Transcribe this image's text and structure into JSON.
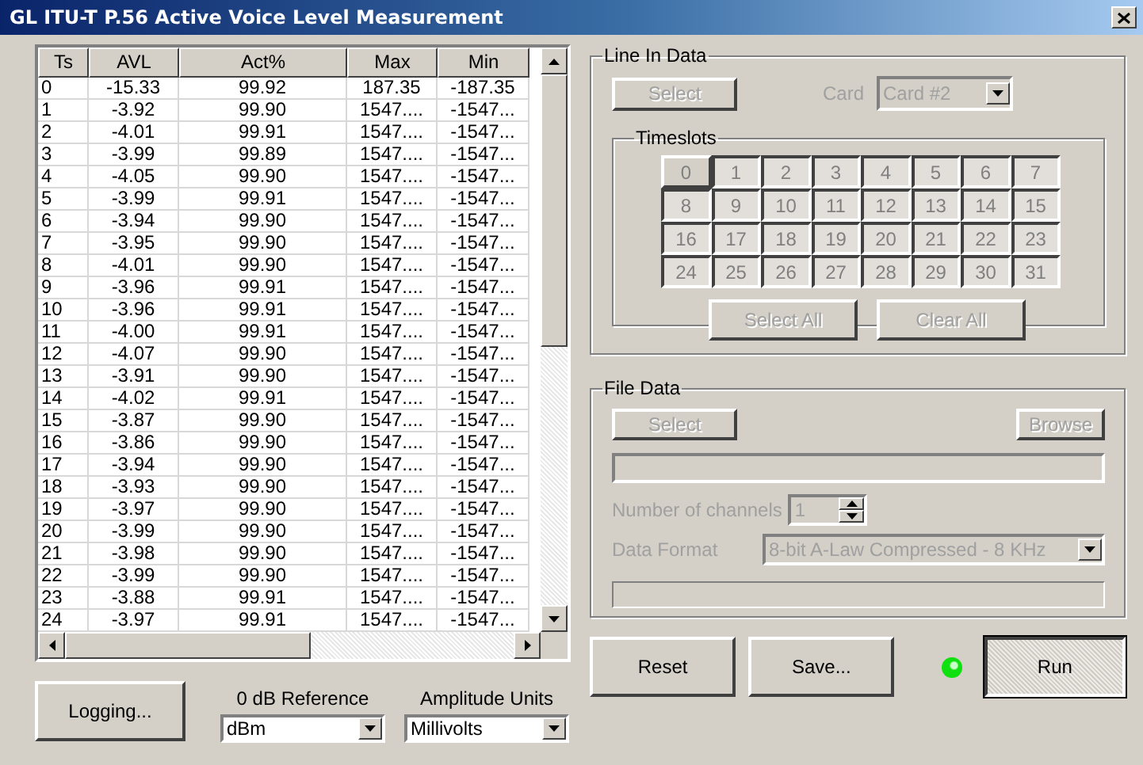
{
  "window": {
    "title": "GL ITU-T P.56 Active Voice Level Measurement"
  },
  "table": {
    "columns": [
      "Ts",
      "AVL",
      "Act%",
      "Max",
      "Min"
    ],
    "rows": [
      [
        "0",
        "-15.33",
        "99.92",
        "187.35",
        "-187.35"
      ],
      [
        "1",
        "-3.92",
        "99.90",
        "1547....",
        "-1547..."
      ],
      [
        "2",
        "-4.01",
        "99.91",
        "1547....",
        "-1547..."
      ],
      [
        "3",
        "-3.99",
        "99.89",
        "1547....",
        "-1547..."
      ],
      [
        "4",
        "-4.05",
        "99.90",
        "1547....",
        "-1547..."
      ],
      [
        "5",
        "-3.99",
        "99.91",
        "1547....",
        "-1547..."
      ],
      [
        "6",
        "-3.94",
        "99.90",
        "1547....",
        "-1547..."
      ],
      [
        "7",
        "-3.95",
        "99.90",
        "1547....",
        "-1547..."
      ],
      [
        "8",
        "-4.01",
        "99.90",
        "1547....",
        "-1547..."
      ],
      [
        "9",
        "-3.96",
        "99.91",
        "1547....",
        "-1547..."
      ],
      [
        "10",
        "-3.96",
        "99.91",
        "1547....",
        "-1547..."
      ],
      [
        "11",
        "-4.00",
        "99.91",
        "1547....",
        "-1547..."
      ],
      [
        "12",
        "-4.07",
        "99.90",
        "1547....",
        "-1547..."
      ],
      [
        "13",
        "-3.91",
        "99.90",
        "1547....",
        "-1547..."
      ],
      [
        "14",
        "-4.02",
        "99.91",
        "1547....",
        "-1547..."
      ],
      [
        "15",
        "-3.87",
        "99.90",
        "1547....",
        "-1547..."
      ],
      [
        "16",
        "-3.86",
        "99.90",
        "1547....",
        "-1547..."
      ],
      [
        "17",
        "-3.94",
        "99.90",
        "1547....",
        "-1547..."
      ],
      [
        "18",
        "-3.93",
        "99.90",
        "1547....",
        "-1547..."
      ],
      [
        "19",
        "-3.97",
        "99.90",
        "1547....",
        "-1547..."
      ],
      [
        "20",
        "-3.99",
        "99.90",
        "1547....",
        "-1547..."
      ],
      [
        "21",
        "-3.98",
        "99.90",
        "1547....",
        "-1547..."
      ],
      [
        "22",
        "-3.99",
        "99.90",
        "1547....",
        "-1547..."
      ],
      [
        "23",
        "-3.88",
        "99.91",
        "1547....",
        "-1547..."
      ],
      [
        "24",
        "-3.97",
        "99.91",
        "1547....",
        "-1547..."
      ]
    ]
  },
  "logging_button": {
    "label": "Logging..."
  },
  "reference": {
    "label": "0 dB Reference",
    "value": "dBm"
  },
  "amplitude_units": {
    "label": "Amplitude Units",
    "value": "Millivolts"
  },
  "line_in": {
    "title": "Line In Data",
    "select": {
      "label": "Select",
      "disabled": true
    },
    "card": {
      "label": "Card",
      "value": "Card #2",
      "disabled": true
    },
    "timeslots": {
      "title": "Timeslots",
      "disabled": true,
      "slots": [
        {
          "label": "0",
          "selected": false
        },
        {
          "label": "1",
          "selected": true
        },
        {
          "label": "2",
          "selected": true
        },
        {
          "label": "3",
          "selected": true
        },
        {
          "label": "4",
          "selected": true
        },
        {
          "label": "5",
          "selected": true
        },
        {
          "label": "6",
          "selected": true
        },
        {
          "label": "7",
          "selected": true
        },
        {
          "label": "8",
          "selected": true
        },
        {
          "label": "9",
          "selected": true
        },
        {
          "label": "10",
          "selected": true
        },
        {
          "label": "11",
          "selected": true
        },
        {
          "label": "12",
          "selected": true
        },
        {
          "label": "13",
          "selected": true
        },
        {
          "label": "14",
          "selected": true
        },
        {
          "label": "15",
          "selected": true
        },
        {
          "label": "16",
          "selected": true
        },
        {
          "label": "17",
          "selected": true
        },
        {
          "label": "18",
          "selected": true
        },
        {
          "label": "19",
          "selected": true
        },
        {
          "label": "20",
          "selected": true
        },
        {
          "label": "21",
          "selected": true
        },
        {
          "label": "22",
          "selected": true
        },
        {
          "label": "23",
          "selected": true
        },
        {
          "label": "24",
          "selected": true
        },
        {
          "label": "25",
          "selected": true
        },
        {
          "label": "26",
          "selected": true
        },
        {
          "label": "27",
          "selected": true
        },
        {
          "label": "28",
          "selected": true
        },
        {
          "label": "29",
          "selected": true
        },
        {
          "label": "30",
          "selected": true
        },
        {
          "label": "31",
          "selected": true
        }
      ],
      "select_all": {
        "label": "Select All",
        "disabled": true
      },
      "clear_all": {
        "label": "Clear All",
        "disabled": true
      }
    }
  },
  "file_data": {
    "title": "File Data",
    "select": {
      "label": "Select",
      "disabled": true
    },
    "browse": {
      "label": "Browse",
      "disabled": true
    },
    "channels": {
      "label": "Number of channels",
      "value": "1",
      "disabled": true
    },
    "data_format": {
      "label": "Data Format",
      "value": "8-bit A-Law Compressed - 8 KHz",
      "disabled": true
    },
    "progress": {
      "level": 0
    }
  },
  "actions": {
    "reset": {
      "label": "Reset"
    },
    "save": {
      "label": "Save..."
    },
    "run": {
      "label": "Run"
    },
    "indicator": {
      "on": true
    }
  }
}
